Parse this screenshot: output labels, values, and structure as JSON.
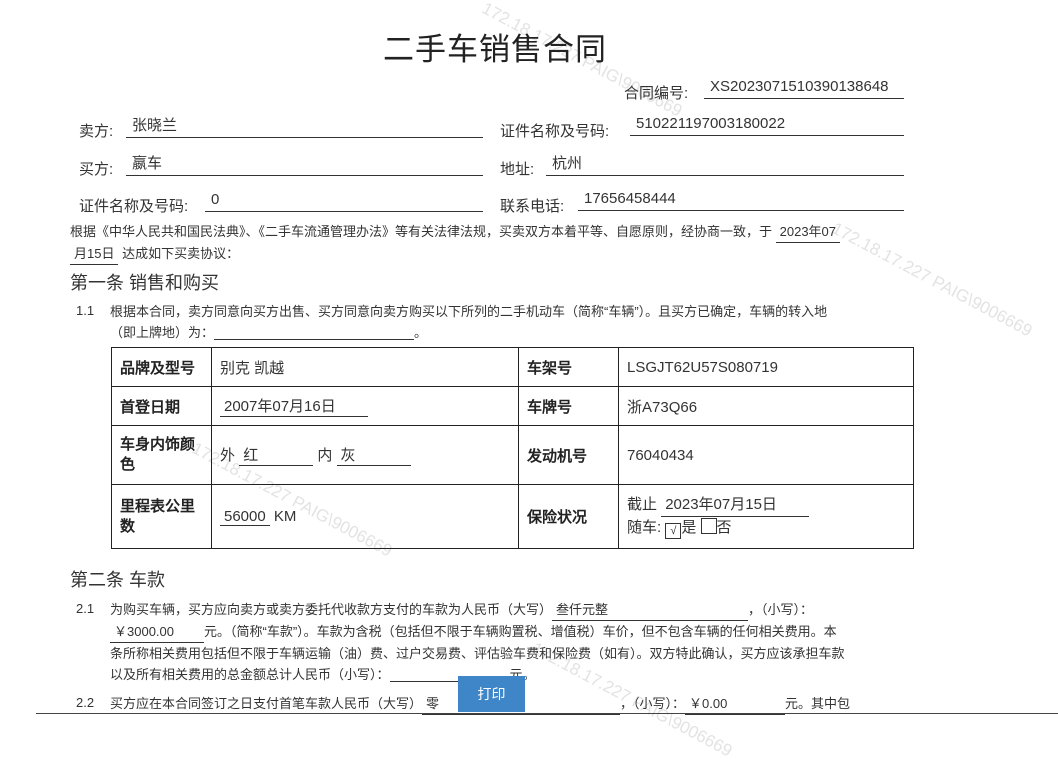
{
  "watermark": {
    "text": "172.18.17.227  PAIG\\9006669"
  },
  "title": "二手车销售合同",
  "contract_no": {
    "label": "合同编号:",
    "value": "XS2023071510390138648"
  },
  "seller": {
    "label": "卖方:",
    "value": "张晓兰"
  },
  "seller_id": {
    "label": "证件名称及号码:",
    "value": "510221197003180022"
  },
  "buyer": {
    "label": "买方:",
    "value": "嬴车"
  },
  "address": {
    "label": "地址:",
    "value": "杭州"
  },
  "buyer_id": {
    "label": "证件名称及号码:",
    "value": "0"
  },
  "phone": {
    "label": "联系电话:",
    "value": "17656458444"
  },
  "intro": {
    "text": "根据《中华人民共和国民法典》、《二手车流通管理办法》等有关法律法规，买卖双方本着平等、自愿原则，经协商一致，于",
    "date_part1": "2023年07",
    "date_part2": "月15日",
    "tail": "达成如下买卖协议："
  },
  "section1": {
    "heading": "第一条 销售和购买",
    "clause_num": "1.1",
    "clause_line1": "根据本合同，卖方同意向买方出售、买方同意向卖方购买以下所列的二手机动车（简称“车辆”）。且买方已确定，车辆的转入地",
    "clause_line2": "（即上牌地）为：",
    "clause_end": "。"
  },
  "vehicle": {
    "brand_label": "品牌及型号",
    "brand_value": "别克 凯越",
    "vin_label": "车架号",
    "vin_value": "LSGJT62U57S080719",
    "reg_label": "首登日期",
    "reg_value": "2007年07月16日",
    "plate_label": "车牌号",
    "plate_value": "浙A73Q66",
    "color_label": "车身内饰颜色",
    "outer_label": "外",
    "outer_value": "红",
    "inner_label": "内",
    "inner_value": "灰",
    "engine_label": "发动机号",
    "engine_value": "76040434",
    "mileage_label": "里程表公里数",
    "mileage_value": "56000",
    "mileage_unit": "KM",
    "insurance_label": "保险状况",
    "ins_until_label": "截止",
    "ins_until_value": "2023年07月15日",
    "ins_with_label": "随车:",
    "ins_yes": "是",
    "ins_no": "否",
    "ins_yes_mark": "√"
  },
  "section2": {
    "heading": "第二条 车款",
    "c21_num": "2.1",
    "c21_text1": "为购买车辆，买方应向卖方或卖方委托代收款方支付的车款为人民币（大写）",
    "c21_upper": "叁仟元整",
    "c21_text2": "，（小写）：",
    "c21_lower": "￥3000.00",
    "c21_text3": "元。（简称“车款”）。车款为含税（包括但不限于车辆购置税、增值税）车价，但不包含车辆的任何相关费用。本",
    "c21_text4": "条所称相关费用包括但不限于车辆运输（油）费、过户交易费、评估验车费和保险费（如有）。双方特此确认，买方应该承担车款",
    "c21_text5": "以及所有相关费用的总金额总计人民币（小写）：",
    "c21_text6": "元。",
    "c22_num": "2.2",
    "c22_text1": "买方应在本合同签订之日支付首笔车款人民币（大写）",
    "c22_upper": "零",
    "c22_text2": "，（小写）：",
    "c22_lower": "￥0.00",
    "c22_text3": "元。其中包"
  },
  "print_button": "打印"
}
